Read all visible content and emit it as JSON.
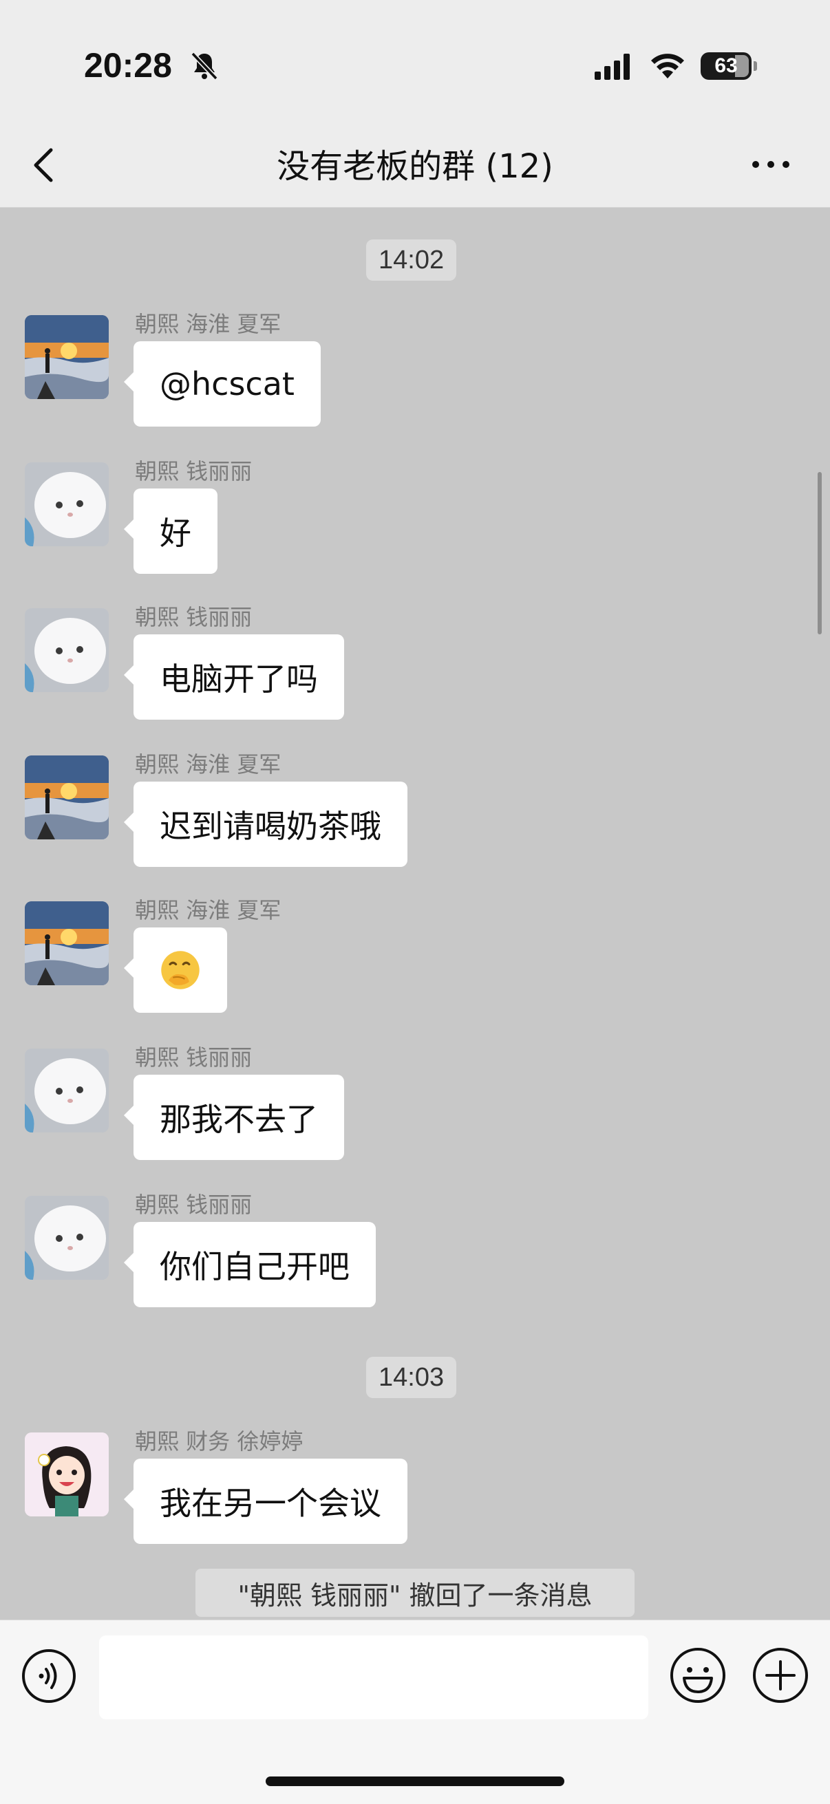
{
  "status_bar": {
    "time": "20:28",
    "battery_level": "63",
    "icons": [
      "bell-muted-icon",
      "signal-icon",
      "wifi-icon",
      "battery-icon"
    ]
  },
  "header": {
    "title": "没有老板的群 (12)",
    "back_icon": "chevron-left-icon",
    "more_icon": "more-dots-icon"
  },
  "messages": {
    "time_1": "14:02",
    "time_2": "14:03",
    "m1": {
      "sender": "朝熙 海淮  夏军",
      "text": "@hcscat",
      "avatar": "mountain-sunset-avatar"
    },
    "m2": {
      "sender": "朝熙  钱丽丽",
      "text": "好",
      "avatar": "white-cat-avatar"
    },
    "m3": {
      "sender": "朝熙  钱丽丽",
      "text": "电脑开了吗",
      "avatar": "white-cat-avatar"
    },
    "m4": {
      "sender": "朝熙 海淮  夏军",
      "text": "迟到请喝奶茶哦",
      "avatar": "mountain-sunset-avatar"
    },
    "m5": {
      "sender": "朝熙 海淮  夏军",
      "text": "🤭",
      "avatar": "mountain-sunset-avatar"
    },
    "m6": {
      "sender": "朝熙  钱丽丽",
      "text": "那我不去了",
      "avatar": "white-cat-avatar"
    },
    "m7": {
      "sender": "朝熙  钱丽丽",
      "text": "你们自己开吧",
      "avatar": "white-cat-avatar"
    },
    "m8": {
      "sender": "朝熙  财务 徐婷婷",
      "text": "我在另一个会议",
      "avatar": "cartoon-girl-avatar"
    },
    "recall_notice": "\"朝熙  钱丽丽\" 撤回了一条消息"
  },
  "input_bar": {
    "placeholder": "",
    "voice_icon": "voice-icon",
    "emoji_icon": "emoji-icon",
    "plus_icon": "plus-icon"
  },
  "colors": {
    "chat_background": "#c8c8c8",
    "bubble": "#ffffff",
    "header": "#ededed",
    "sender_text": "#7c7c7c"
  }
}
